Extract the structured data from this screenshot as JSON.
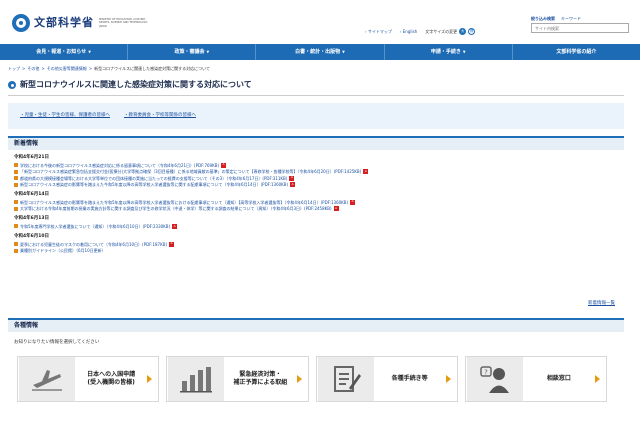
{
  "header": {
    "logo_text": "文部科学省",
    "logo_sub": "MINISTRY OF EDUCATION, CULTURE, SPORTS, SCIENCE AND TECHNOLOGY-JAPAN",
    "sitemap": "サイトマップ",
    "english": "English",
    "fontsize_label": "文字サイズの変更",
    "fontsize_large": "大",
    "fontsize_standard": "標",
    "search_tab_detail": "絞り込み検索",
    "search_tab_keyword": "キーワード",
    "search_placeholder": "サイト内検索"
  },
  "nav": {
    "items": [
      "会見・報道・お知らせ",
      "政策・審議会",
      "白書・統計・出版物",
      "申請・手続き",
      "文部科学省の紹介"
    ]
  },
  "breadcrumb": {
    "items": [
      "トップ",
      "その他",
      "その他災害等関連情報"
    ],
    "current": "新型コロナウイルスに関連した感染症対策に関する対応について"
  },
  "page": {
    "title": "新型コロナウイルスに関連した感染症対策に関する対応について"
  },
  "related": {
    "link1": "・児童・生徒・学生の皆様、保護者の皆様へ",
    "link2": "・教育委員会・学校等関係の皆様へ"
  },
  "news": {
    "heading": "新着情報",
    "groups": [
      {
        "date": "令和4年6月21日",
        "items": [
          "学校における今後の新型コロナウイルス感染症対応に係る留意事項について（令和4年6月21日）(PDF:769KB)",
          "「新型コロナウイルス感染症緊急包括支援交付金(医療分)大学等拠点確保（3回目接種）に係る地域貢献の基準」の策定について【専修学校・各種学校等】（令和4年6月20日）(PDF:1425KB)",
          "都道府県の大規模接種会場等における大学等単位での団体接種の実施に当たっての経費の支援等について（その3）（令和4年6月17日）(PDF:311KB)",
          "新型コロナウイルス感染症の影響等を踏まえた今和5年度以降の高等学校入学者選抜等に関する配慮事項について（令和4年6月14日）(PDF:1360KB)"
        ]
      },
      {
        "date": "令和4年6月14日",
        "items": [
          "新型コロナウイルス感染症の影響等を踏まえた令和5年度以降の高等学校入学者選抜等における配慮事項について（通知）【高等学校入学者選抜等】（令和4年6月14日）(PDF:1360KB)",
          "大学等における令和4年度前期の授業の実施方針等に関する調査及び学生の修学状況（中退・休学）等に関する調査の結果について（周知）（令和4年6月3日）(PDF:2458KB)"
        ]
      },
      {
        "date": "令和4年6月13日",
        "items": [
          "令和5年度専門学校入学者選抜について（通知）（令和4年6月10日）(PDF:2330KB)"
        ]
      },
      {
        "date": "令和4年6月10日",
        "items": [
          "夏季における児童生徒のマスクの着用について（令和4年6月10日）(PDF:187KB)",
          "業種別ガイドライン（公民館）（6月10日更新）"
        ]
      }
    ],
    "more": "新着情報一覧"
  },
  "info": {
    "heading": "各種情報",
    "note": "お知りになりたい情報を選択してください",
    "cards": [
      {
        "label1": "日本への入国申請",
        "label2": "(受入機関の皆様)",
        "icon": "airplane-icon"
      },
      {
        "label1": "緊急経済対策・",
        "label2": "補正予算による取組",
        "icon": "bar-chart-icon"
      },
      {
        "label1": "各種手続き等",
        "label2": "",
        "icon": "form-pen-icon"
      },
      {
        "label1": "相談窓口",
        "label2": "",
        "icon": "person-question-icon"
      }
    ]
  },
  "colors": {
    "nav_blue": "#1e6bb5",
    "link": "#1a4fa0",
    "accent_orange": "#e59b14",
    "pdf_red": "#d42020"
  }
}
